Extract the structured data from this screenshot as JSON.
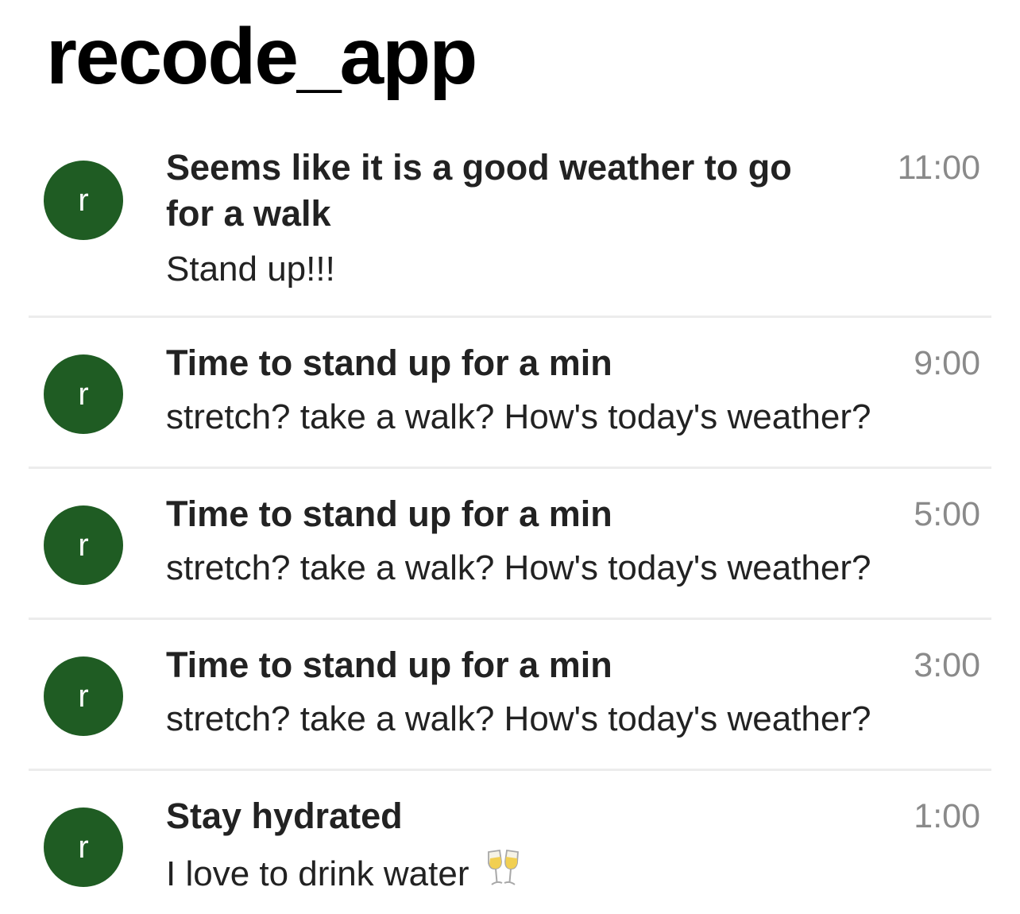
{
  "app": {
    "title": "recode_app"
  },
  "colors": {
    "avatar_bg": "#1f5c23",
    "time_text": "#8a8a8a",
    "divider": "#ececec"
  },
  "notifications": [
    {
      "avatar_letter": "r",
      "title": "Seems like it is a good weather to go for a walk",
      "text": "Stand up!!!",
      "time": "11:00"
    },
    {
      "avatar_letter": "r",
      "title": "Time to stand up for a min",
      "text": "stretch? take a walk? How's today's weather?",
      "time": "9:00"
    },
    {
      "avatar_letter": "r",
      "title": "Time to stand up for a min",
      "text": "stretch? take a walk? How's today's weather?",
      "time": "5:00"
    },
    {
      "avatar_letter": "r",
      "title": "Time to stand up for a min",
      "text": "stretch? take a walk? How's today's weather?",
      "time": "3:00"
    },
    {
      "avatar_letter": "r",
      "title": "Stay hydrated",
      "text": "I love to drink water",
      "time": "1:00",
      "trailing_icon": "clinking-glasses-icon"
    }
  ]
}
